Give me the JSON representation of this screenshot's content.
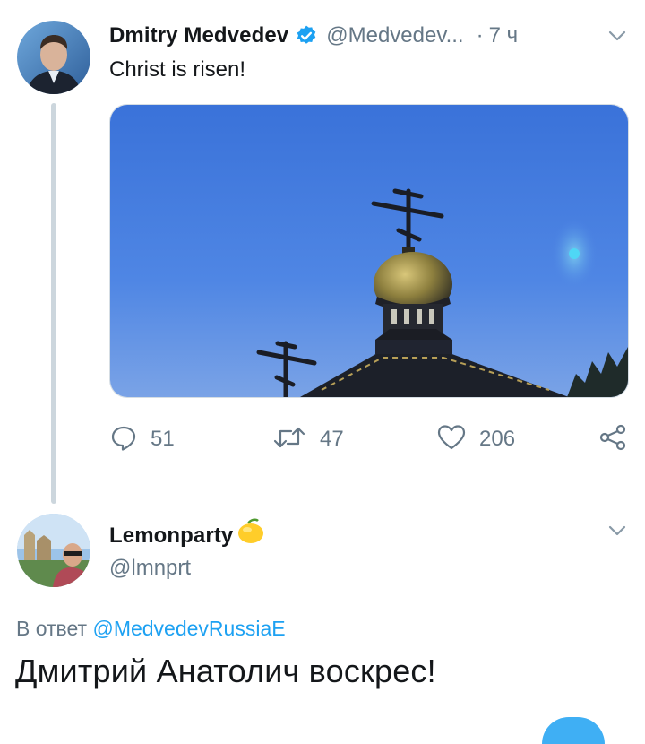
{
  "tweet": {
    "author_name": "Dmitry Medvedev",
    "verified_icon": "verified-badge-icon",
    "handle": "@Medvedev...",
    "separator": "·",
    "time": "7 ч",
    "text": "Christ is risen!",
    "media_alt": "",
    "actions": {
      "reply_count": "51",
      "retweet_count": "47",
      "like_count": "206"
    }
  },
  "reply": {
    "author_name": "Lemonparty",
    "emoji": "🍋",
    "handle": "@lmnprt",
    "in_reply_prefix": "В ответ",
    "in_reply_handle": "@MedvedevRussiaE",
    "text": "Дмитрий Анатолич воскрес!"
  },
  "colors": {
    "link": "#1da1f2",
    "muted": "#657786",
    "text": "#14171a",
    "sky": "#3f7fe0"
  }
}
